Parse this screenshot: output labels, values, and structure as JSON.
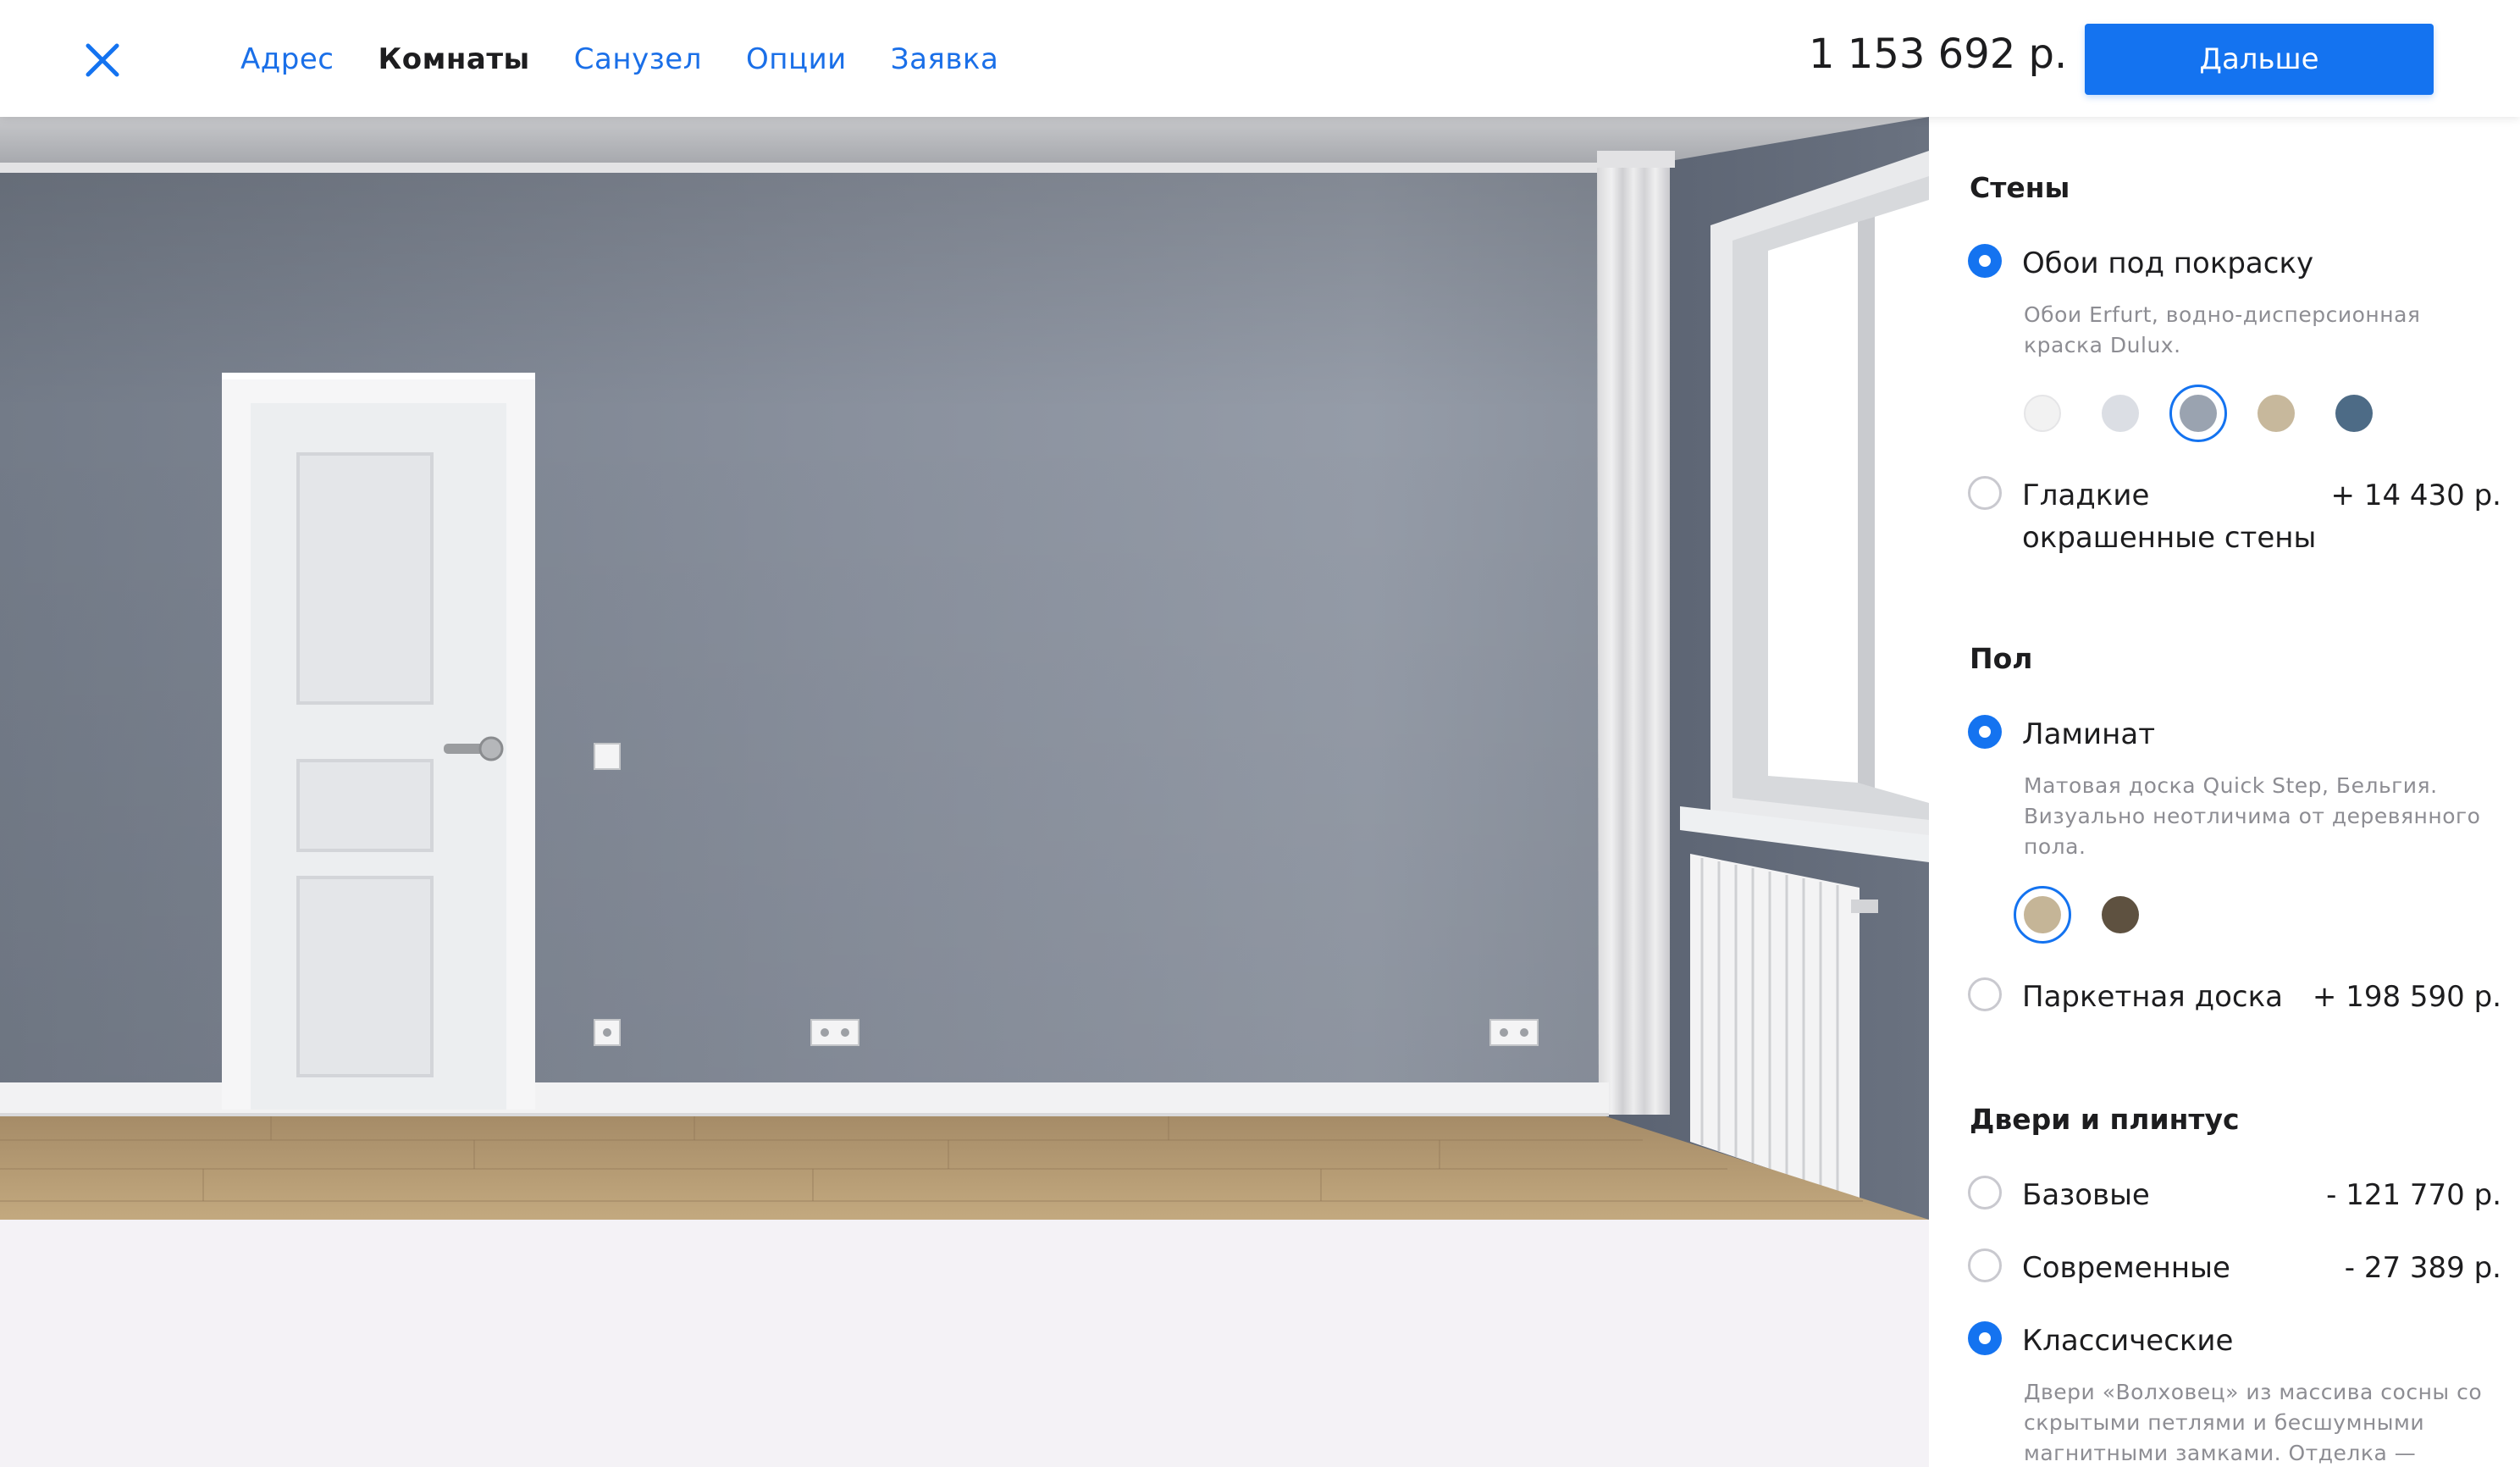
{
  "header": {
    "nav": [
      "Адрес",
      "Комнаты",
      "Санузел",
      "Опции",
      "Заявка"
    ],
    "active_index": 1,
    "total_price": "1 153 692 р.",
    "next_label": "Дальше"
  },
  "panel": {
    "walls": {
      "title": "Стены",
      "option1": {
        "label": "Обои под покраску",
        "description": "Обои Erfurt, водно-дисперсионная краска Dulux.",
        "selected": true,
        "swatches": [
          "#f2f2f2",
          "#dbdee4",
          "#9aa3b0",
          "#c7b89c",
          "#4d6b86"
        ],
        "selected_swatch": 2
      },
      "option2": {
        "label": "Гладкие окрашенные стены",
        "price": "+ 14 430 р.",
        "selected": false
      }
    },
    "floor": {
      "title": "Пол",
      "option1": {
        "label": "Ламинат",
        "description": "Матовая доска Quick Step, Бельгия. Визуально неотличима от деревянного пола.",
        "selected": true,
        "swatches": [
          "#c5b597",
          "#5e5140"
        ],
        "selected_swatch": 0
      },
      "option2": {
        "label": "Паркетная доска",
        "price": "+ 198 590 р.",
        "selected": false
      }
    },
    "doors": {
      "title": "Двери и плинтус",
      "option1": {
        "label": "Базовые",
        "price": "- 121 770 р.",
        "selected": false
      },
      "option2": {
        "label": "Современные",
        "price": "- 27 389 р.",
        "selected": false
      },
      "option3": {
        "label": "Классические",
        "description": "Двери «Волховец» из массива сосны со скрытыми петлями и бесшумными магнитными замками. Отделка —",
        "selected": true
      }
    }
  },
  "colors": {
    "accent": "#1473f0",
    "wall": "#8b929f",
    "floor": "#b89d77",
    "background": "#f4f2f6"
  }
}
